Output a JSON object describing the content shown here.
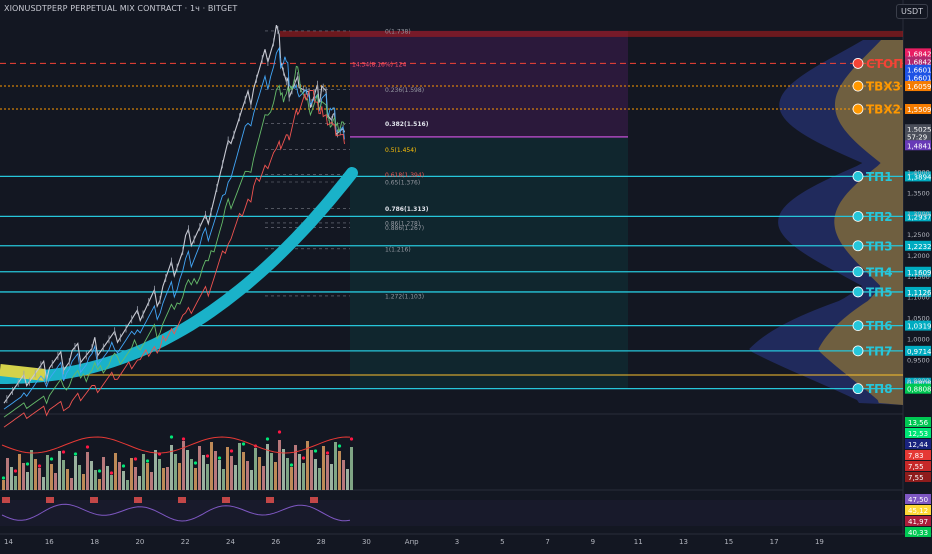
{
  "header": {
    "title": "XIONUSDTPERP PERPETUAL MIX CONTRACT · 1ч · BITGET",
    "unit": "USDT"
  },
  "chart_data": {
    "type": "line",
    "symbol": "XIONUSDTPERP PERPETUAL MIX CONTRACT",
    "interval": "1ч",
    "exchange": "BITGET",
    "x_ticks": [
      "14",
      "16",
      "18",
      "20",
      "22",
      "24",
      "26",
      "28",
      "30",
      "Апр",
      "3",
      "5",
      "7",
      "9",
      "11",
      "13",
      "15",
      "17",
      "19"
    ],
    "y_ticks": [
      "1,4000",
      "1,3500",
      "1,3000",
      "1,2500",
      "1,2000",
      "1,1500",
      "1,1000",
      "1,0500",
      "1,0000",
      "0,9500",
      "0,9000",
      "0,8500"
    ],
    "price_series": {
      "name": "",
      "x": [
        "14",
        "15",
        "16",
        "17",
        "18",
        "19",
        "20",
        "21",
        "22",
        "23",
        "24",
        "25",
        "26",
        "26.5",
        "27",
        "27.5",
        "28",
        "28.5",
        "29"
      ],
      "values": [
        0.87,
        0.9,
        0.93,
        0.96,
        0.98,
        1.01,
        1.05,
        1.12,
        1.23,
        1.3,
        1.48,
        1.6,
        1.74,
        1.6,
        1.62,
        1.56,
        1.6,
        1.52,
        1.495
      ]
    },
    "fib_levels": [
      {
        "label": "0(1.738)",
        "price": 1.738
      },
      {
        "label": "0.236(1.598)",
        "price": 1.598
      },
      {
        "label": "0.382(1.516)",
        "price": 1.516
      },
      {
        "label": "0.5(1.454)",
        "price": 1.454
      },
      {
        "label": "0.618(1.394)",
        "price": 1.394
      },
      {
        "label": "0.65(1.376)",
        "price": 1.376
      },
      {
        "label": "0.786(1.313)",
        "price": 1.313
      },
      {
        "label": "0.86(1.278)",
        "price": 1.278
      },
      {
        "label": "0.886(1.267)",
        "price": 1.267
      },
      {
        "label": "1(1.216)",
        "price": 1.216
      },
      {
        "label": "1.272(1.103)",
        "price": 1.103
      }
    ],
    "level_labels": [
      {
        "name": "СТОП",
        "price": 1.6601,
        "color": "#f44336"
      },
      {
        "name": "ТВХ3",
        "price": 1.6059,
        "color": "#ff9800"
      },
      {
        "name": "ТВХ2",
        "price": 1.5509,
        "color": "#ff9800"
      },
      {
        "name": "ТП1",
        "price": 1.3894,
        "color": "#26c6da"
      },
      {
        "name": "ТП2",
        "price": 1.2937,
        "color": "#26c6da"
      },
      {
        "name": "ТП3",
        "price": 1.2232,
        "color": "#26c6da"
      },
      {
        "name": "ТП4",
        "price": 1.1609,
        "color": "#26c6da"
      },
      {
        "name": "ТП5",
        "price": 1.1126,
        "color": "#26c6da"
      },
      {
        "name": "ТП6",
        "price": 1.0319,
        "color": "#26c6da"
      },
      {
        "name": "ТП7",
        "price": 0.9714,
        "color": "#26c6da"
      },
      {
        "name": "ТП8",
        "price": 0.8808,
        "color": "#26c6da"
      }
    ],
    "stop_text": "14.34(8.16%) 124",
    "price_badges": [
      {
        "text": "1,6842",
        "price": 1.6842,
        "bg": "#e91e63"
      },
      {
        "text": "1,6842",
        "price": 1.665,
        "bg": "#b2286e"
      },
      {
        "text": "1,6601",
        "price": 1.645,
        "bg": "#1e53e5"
      },
      {
        "text": "1,6601",
        "price": 1.626,
        "bg": "#1e53e5"
      },
      {
        "text": "1,6059",
        "price": 1.6059,
        "bg": "#f57c00"
      },
      {
        "text": "1,5509",
        "price": 1.5509,
        "bg": "#f57c00"
      },
      {
        "text": "1,5025",
        "price": 1.5025,
        "bg": "#4a4e5a"
      },
      {
        "text": "57:29",
        "price": 1.4845,
        "bg": "#4a4e5a"
      },
      {
        "text": "1,4841",
        "price": 1.464,
        "bg": "#673ab7"
      },
      {
        "text": "1,3894",
        "price": 1.3894,
        "bg": "#00acc1"
      },
      {
        "text": "1,2937",
        "price": 1.2937,
        "bg": "#00acc1"
      },
      {
        "text": "1,2232",
        "price": 1.2232,
        "bg": "#00acc1"
      },
      {
        "text": "1,1609",
        "price": 1.1609,
        "bg": "#00acc1"
      },
      {
        "text": "1,1126",
        "price": 1.1126,
        "bg": "#00acc1"
      },
      {
        "text": "1,0319",
        "price": 1.0319,
        "bg": "#00acc1"
      },
      {
        "text": "0,9714",
        "price": 0.9714,
        "bg": "#00acc1"
      },
      {
        "text": "0,8808",
        "price": 0.895,
        "bg": "#00acc1"
      },
      {
        "text": "0,8808",
        "price": 0.8808,
        "bg": "#00c853"
      }
    ],
    "osc1_badges": [
      {
        "text": "13,56",
        "bg": "#00c853"
      },
      {
        "text": "12,53",
        "bg": "#00e676"
      },
      {
        "text": "12,44",
        "bg": "#1a237e"
      },
      {
        "text": "7,83",
        "bg": "#e53935"
      },
      {
        "text": "7,55",
        "bg": "#c62828"
      },
      {
        "text": "7,55",
        "bg": "#8e1c1c"
      }
    ],
    "osc2_badges": [
      {
        "text": "47,50",
        "bg": "#7e57c2"
      },
      {
        "text": "45,12",
        "bg": "#fdd835"
      },
      {
        "text": "41,97",
        "bg": "#ab1d3a"
      },
      {
        "text": "40,33",
        "bg": "#00c853"
      }
    ],
    "colors": {
      "background": "#131722",
      "cyan": "#26c6da",
      "stop": "#f44336",
      "entry": "#ff9800",
      "ema_band": "#1ab2c9",
      "ema_band_early": "#d4d24a"
    }
  }
}
